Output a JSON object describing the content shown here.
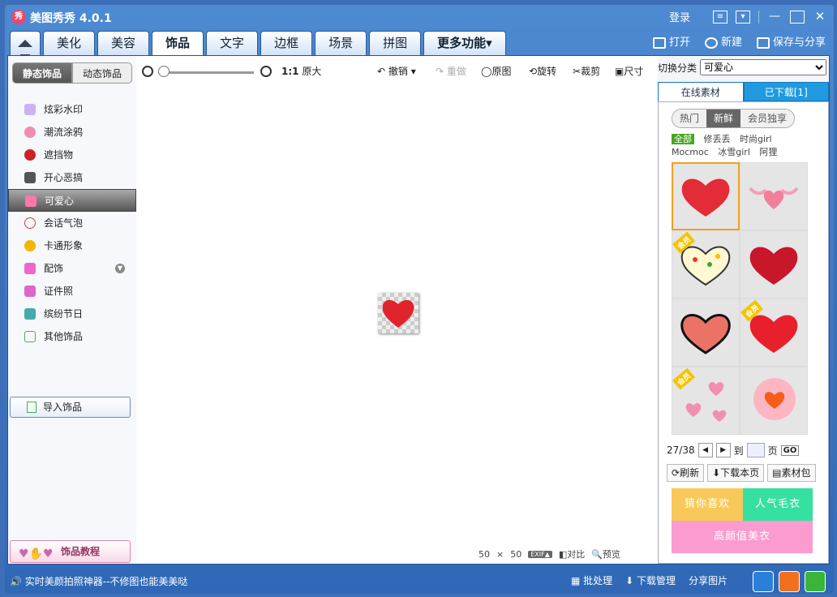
{
  "app": {
    "title": "美图秀秀 4.0.1",
    "logo": "秀",
    "login": "登录"
  },
  "nav": {
    "tabs": [
      "美化",
      "美容",
      "饰品",
      "文字",
      "边框",
      "场景",
      "拼图"
    ],
    "more": "更多功能▾"
  },
  "file": {
    "open": "打开",
    "new": "新建",
    "save": "保存与分享"
  },
  "left": {
    "tabs": [
      "静态饰品",
      "动态饰品"
    ],
    "categories": [
      "炫彩水印",
      "潮流涂鸦",
      "遮挡物",
      "开心恶搞",
      "可爱心",
      "会话气泡",
      "卡通形象",
      "配饰",
      "证件照",
      "缤纷节日",
      "其他饰品"
    ],
    "import": "导入饰品",
    "tutorial": "饰品教程"
  },
  "toolbar": {
    "ratio": "1:1",
    "original_size": "原大",
    "undo": "撤销",
    "redo": "重做",
    "original": "原图",
    "rotate": "旋转",
    "crop": "裁剪",
    "size": "尺寸"
  },
  "canvas": {
    "w": "50",
    "times": "×",
    "h": "50",
    "exif": "EXIF▲",
    "compare": "对比",
    "preview": "预览"
  },
  "right": {
    "switch_label": "切换分类",
    "switch_value": "可爱心",
    "tabs": [
      "在线素材",
      "已下载[1]"
    ],
    "filters": [
      "热门",
      "新鲜",
      "会员独享"
    ],
    "tags": [
      "全部",
      "修丢丢",
      "时尚girl",
      "Mocmoc",
      "冰雪girl",
      "阿狸"
    ],
    "vip": "会员",
    "pager": {
      "page": "27/38",
      "to": "到",
      "unit": "页",
      "go": "GO"
    },
    "actions": [
      "刷新",
      "下载本页",
      "素材包"
    ],
    "ads": [
      "猜你喜欢",
      "人气毛衣",
      "高颜值美衣"
    ]
  },
  "status": {
    "msg": "实时美颜拍照神器--不修图也能美美哒",
    "batch": "批处理",
    "download": "下载管理",
    "share": "分享图片"
  }
}
